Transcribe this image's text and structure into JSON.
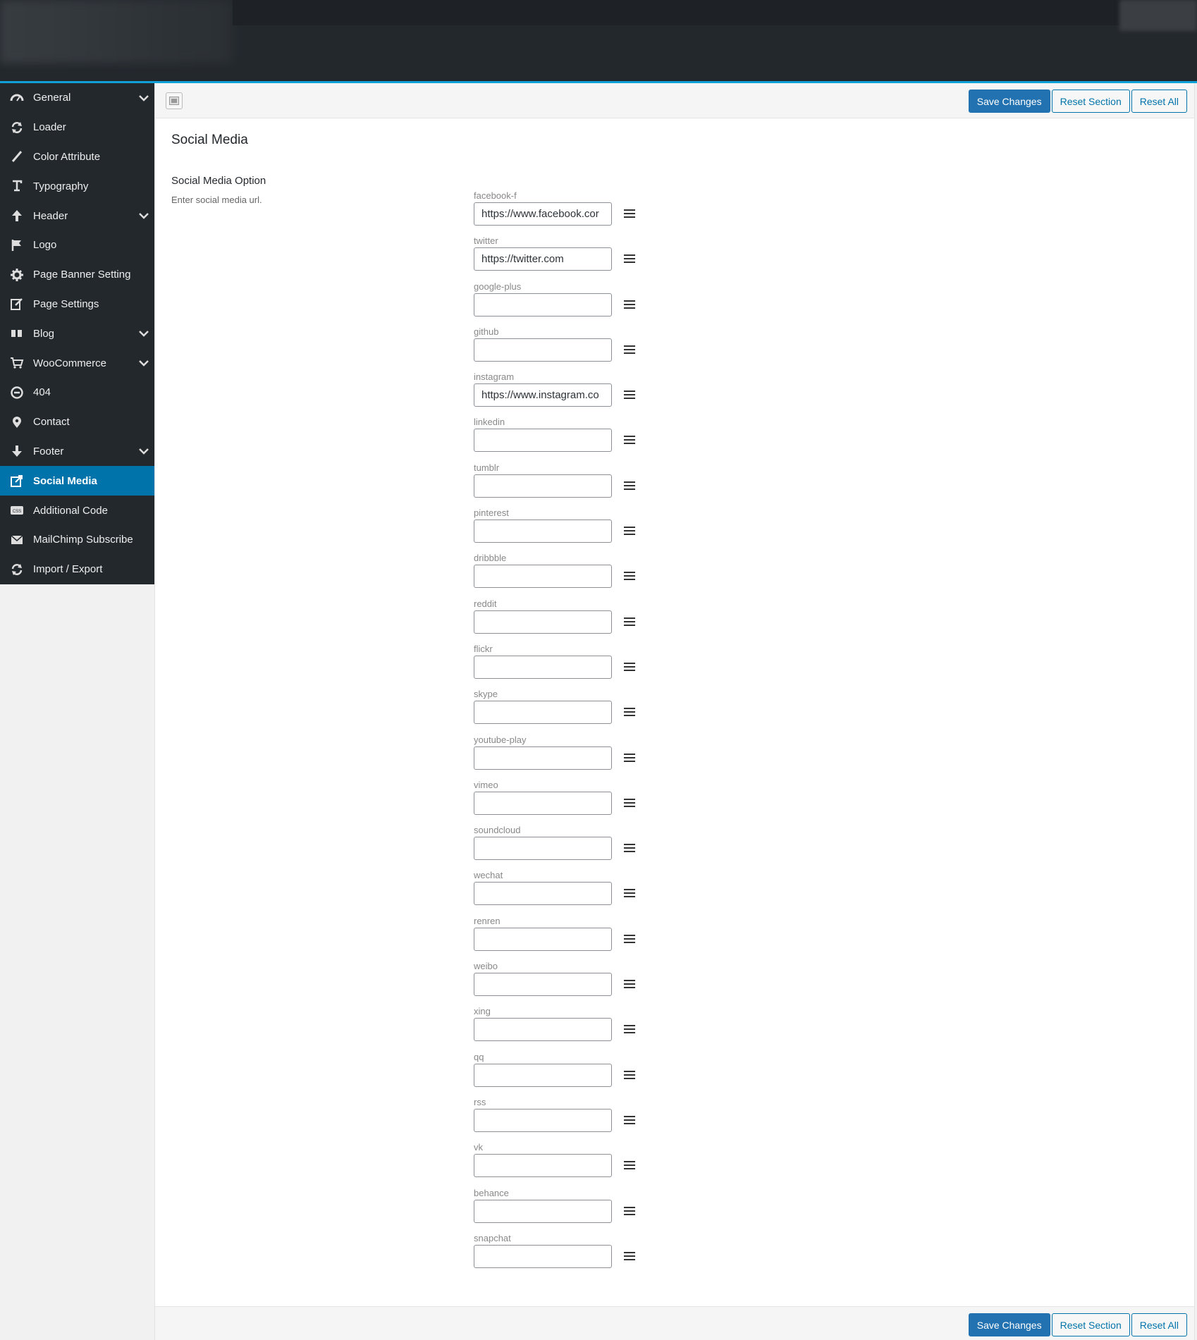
{
  "sidebar": {
    "items": [
      {
        "label": "General",
        "icon": "gauge-icon",
        "has_submenu": true
      },
      {
        "label": "Loader",
        "icon": "refresh-icon",
        "has_submenu": false
      },
      {
        "label": "Color Attribute",
        "icon": "brush-icon",
        "has_submenu": false
      },
      {
        "label": "Typography",
        "icon": "text-icon",
        "has_submenu": false
      },
      {
        "label": "Header",
        "icon": "arrow-up-icon",
        "has_submenu": true
      },
      {
        "label": "Logo",
        "icon": "flag-icon",
        "has_submenu": false
      },
      {
        "label": "Page Banner Setting",
        "icon": "gear-icon",
        "has_submenu": false
      },
      {
        "label": "Page Settings",
        "icon": "edit-icon",
        "has_submenu": false
      },
      {
        "label": "Blog",
        "icon": "quote-icon",
        "has_submenu": true
      },
      {
        "label": "WooCommerce",
        "icon": "cart-icon",
        "has_submenu": true
      },
      {
        "label": "404",
        "icon": "minus-circle-icon",
        "has_submenu": false
      },
      {
        "label": "Contact",
        "icon": "map-pin-icon",
        "has_submenu": false
      },
      {
        "label": "Footer",
        "icon": "arrow-down-icon",
        "has_submenu": true
      },
      {
        "label": "Social Media",
        "icon": "share-icon",
        "has_submenu": false,
        "active": true
      },
      {
        "label": "Additional Code",
        "icon": "css-icon",
        "has_submenu": false
      },
      {
        "label": "MailChimp Subscribe",
        "icon": "envelope-icon",
        "has_submenu": false
      },
      {
        "label": "Import / Export",
        "icon": "refresh-icon",
        "has_submenu": false
      }
    ]
  },
  "toolbar": {
    "save_label": "Save Changes",
    "reset_section_label": "Reset Section",
    "reset_all_label": "Reset All"
  },
  "main": {
    "section_title": "Social Media",
    "option_title": "Social Media Option",
    "option_desc": "Enter social media url."
  },
  "fields": [
    {
      "label": "facebook-f",
      "value": "https://www.facebook.cor"
    },
    {
      "label": "twitter",
      "value": "https://twitter.com"
    },
    {
      "label": "google-plus",
      "value": ""
    },
    {
      "label": "github",
      "value": ""
    },
    {
      "label": "instagram",
      "value": "https://www.instagram.co"
    },
    {
      "label": "linkedin",
      "value": ""
    },
    {
      "label": "tumblr",
      "value": ""
    },
    {
      "label": "pinterest",
      "value": ""
    },
    {
      "label": "dribbble",
      "value": ""
    },
    {
      "label": "reddit",
      "value": ""
    },
    {
      "label": "flickr",
      "value": ""
    },
    {
      "label": "skype",
      "value": ""
    },
    {
      "label": "youtube-play",
      "value": ""
    },
    {
      "label": "vimeo",
      "value": ""
    },
    {
      "label": "soundcloud",
      "value": ""
    },
    {
      "label": "wechat",
      "value": ""
    },
    {
      "label": "renren",
      "value": ""
    },
    {
      "label": "weibo",
      "value": ""
    },
    {
      "label": "xing",
      "value": ""
    },
    {
      "label": "qq",
      "value": ""
    },
    {
      "label": "rss",
      "value": ""
    },
    {
      "label": "vk",
      "value": ""
    },
    {
      "label": "behance",
      "value": ""
    },
    {
      "label": "snapchat",
      "value": ""
    }
  ],
  "colors": {
    "sidebar_bg": "#23282d",
    "active_bg": "#0073aa",
    "primary_button": "#2271b1",
    "accent_line": "#0ea0d6"
  }
}
